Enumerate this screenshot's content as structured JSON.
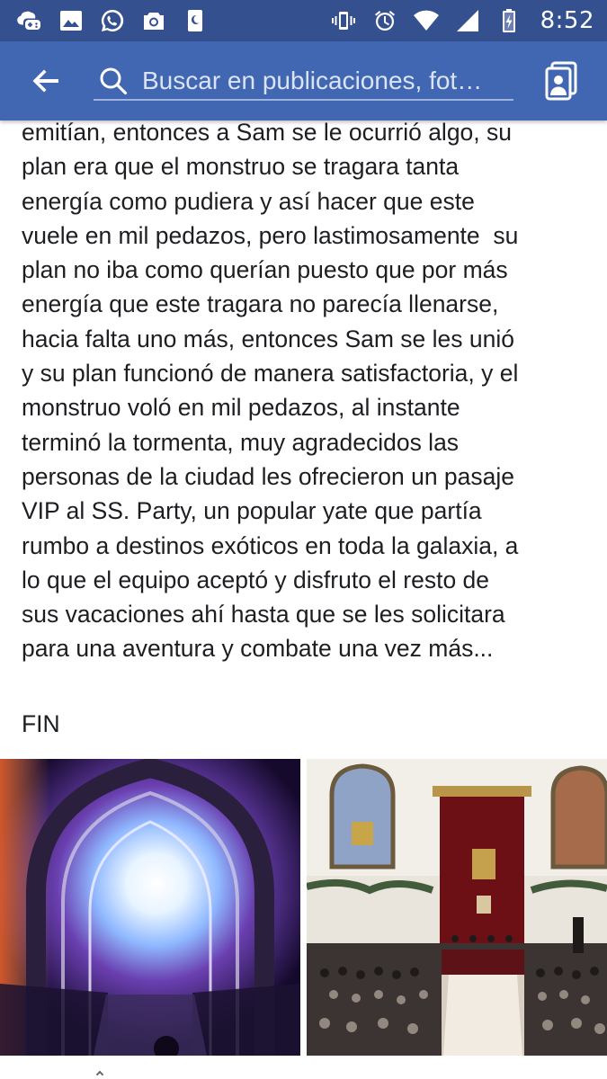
{
  "status_bar": {
    "time": "8:52",
    "left_icons": [
      "game-controller-cloud-icon",
      "image-icon",
      "whatsapp-icon",
      "camera-icon",
      "night-mode-icon"
    ],
    "right_icons": [
      "vibrate-icon",
      "alarm-icon",
      "wifi-icon",
      "signal-icon",
      "battery-charging-icon"
    ],
    "background": "#34508f"
  },
  "app_bar": {
    "background": "#4267b2",
    "search": {
      "placeholder": "Buscar en publicaciones, fot…"
    }
  },
  "post": {
    "lines": [
      "emitían, entonces a Sam se le ocurrió algo, su",
      "plan era que el monstruo se tragara tanta",
      "energía como pudiera y así hacer que este",
      "vuele en mil pedazos, pero lastimosamente  su",
      "plan no iba como querían puesto que por más",
      "energía que este tragara no parecía llenarse,",
      "hacia falta uno más, entonces Sam se les unió",
      "y su plan funcionó de manera satisfactoria, y el",
      "monstruo voló en mil pedazos, al instante",
      "terminó la tormenta, muy agradecidos las",
      "personas de la ciudad les ofrecieron un pasaje",
      "VIP al SS. Party, un popular yate que partía",
      "rumbo a destinos exóticos en toda la galaxia, a",
      "lo que el equipo aceptó y disfruto el resto de",
      "sus vacaciones ahí hasta que se les solicitara",
      "para una aventura y combate una vez más..."
    ],
    "ending": "FIN"
  },
  "photos": [
    {
      "subject": "cosmic-portal-gate"
    },
    {
      "subject": "ceremonial-hall-audience"
    }
  ]
}
